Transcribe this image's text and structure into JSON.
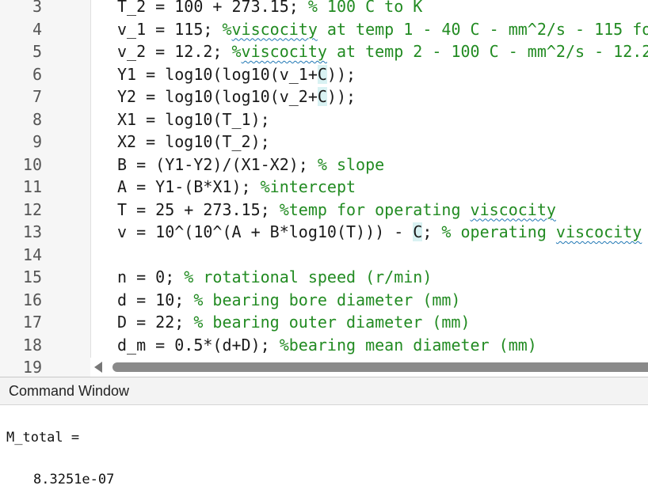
{
  "editor": {
    "lines": [
      {
        "n": "3",
        "segs": [
          {
            "t": "T_2 = 100 + 273.15; ",
            "c": ""
          },
          {
            "t": "% 100 C to K",
            "c": "cm"
          }
        ]
      },
      {
        "n": "4",
        "segs": [
          {
            "t": "v_1 = 115; ",
            "c": ""
          },
          {
            "t": "%",
            "c": "cm"
          },
          {
            "t": "viscocity",
            "c": "cm sq"
          },
          {
            "t": " at temp 1 - 40 C - mm^2/s - 115 fo",
            "c": "cm"
          }
        ]
      },
      {
        "n": "5",
        "segs": [
          {
            "t": "v_2 = 12.2; ",
            "c": ""
          },
          {
            "t": "%",
            "c": "cm"
          },
          {
            "t": "viscocity",
            "c": "cm sq"
          },
          {
            "t": " at temp 2 - 100 C - mm^2/s - 12.2",
            "c": "cm"
          }
        ]
      },
      {
        "n": "6",
        "segs": [
          {
            "t": "Y1 = log10(log10(v_1+",
            "c": ""
          },
          {
            "t": "C",
            "c": "hl"
          },
          {
            "t": "));",
            "c": ""
          }
        ]
      },
      {
        "n": "7",
        "segs": [
          {
            "t": "Y2 = log10(log10(v_2+",
            "c": ""
          },
          {
            "t": "C",
            "c": "hl"
          },
          {
            "t": "));",
            "c": ""
          }
        ]
      },
      {
        "n": "8",
        "segs": [
          {
            "t": "X1 = log10(T_1);",
            "c": ""
          }
        ]
      },
      {
        "n": "9",
        "segs": [
          {
            "t": "X2 = log10(T_2);",
            "c": ""
          }
        ]
      },
      {
        "n": "10",
        "segs": [
          {
            "t": "B = (Y1-Y2)/(X1-X2); ",
            "c": ""
          },
          {
            "t": "% slope",
            "c": "cm"
          }
        ]
      },
      {
        "n": "11",
        "segs": [
          {
            "t": "A = Y1-(B*X1); ",
            "c": ""
          },
          {
            "t": "%intercept",
            "c": "cm"
          }
        ]
      },
      {
        "n": "12",
        "segs": [
          {
            "t": "T = 25 + 273.15; ",
            "c": ""
          },
          {
            "t": "%temp for operating ",
            "c": "cm"
          },
          {
            "t": "viscocity",
            "c": "cm sq"
          }
        ]
      },
      {
        "n": "13",
        "segs": [
          {
            "t": "v = 10^(10^(A + B*log10(T))) - ",
            "c": ""
          },
          {
            "t": "C",
            "c": "hl"
          },
          {
            "t": "; ",
            "c": ""
          },
          {
            "t": "% operating ",
            "c": "cm"
          },
          {
            "t": "viscocity",
            "c": "cm sq"
          }
        ]
      },
      {
        "n": "14",
        "segs": []
      },
      {
        "n": "15",
        "segs": [
          {
            "t": "n = 0; ",
            "c": ""
          },
          {
            "t": "% rotational speed (r/min)",
            "c": "cm"
          }
        ]
      },
      {
        "n": "16",
        "segs": [
          {
            "t": "d = 10; ",
            "c": ""
          },
          {
            "t": "% bearing bore diameter (mm)",
            "c": "cm"
          }
        ]
      },
      {
        "n": "17",
        "segs": [
          {
            "t": "D = 22; ",
            "c": ""
          },
          {
            "t": "% bearing outer diameter (mm)",
            "c": "cm"
          }
        ]
      },
      {
        "n": "18",
        "segs": [
          {
            "t": "d_m = 0.5*(d+D); ",
            "c": ""
          },
          {
            "t": "%bearing mean diameter (mm)",
            "c": "cm"
          }
        ]
      },
      {
        "n": "19",
        "segs": []
      }
    ]
  },
  "command_window": {
    "title": "Command Window",
    "output_var": "M_total =",
    "output_value": "8.3251e-07"
  },
  "colors": {
    "comment": "#228b22",
    "squiggle": "#1f77b4",
    "highlight": "#d9f2f3"
  }
}
